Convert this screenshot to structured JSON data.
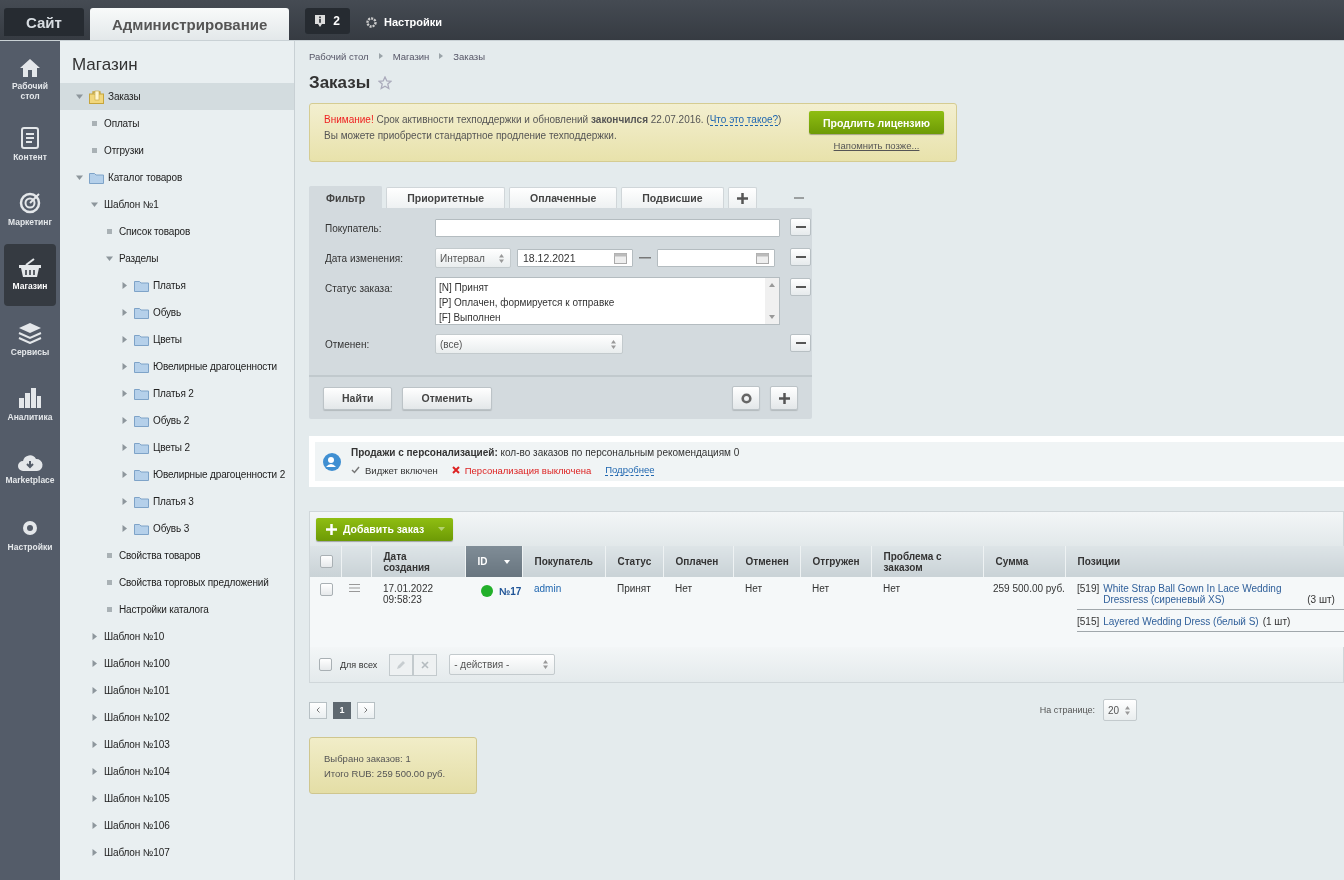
{
  "topbar": {
    "tabs": [
      {
        "label": "Сайт",
        "selected": false
      },
      {
        "label": "Администрирование",
        "selected": true
      }
    ],
    "notifications": "2",
    "settings": "Настройки"
  },
  "nav": [
    {
      "label": "Рабочий стол",
      "selected": false
    },
    {
      "label": "Контент",
      "selected": false
    },
    {
      "label": "Маркетинг",
      "selected": false
    },
    {
      "label": "Магазин",
      "selected": true
    },
    {
      "label": "Сервисы",
      "selected": false
    },
    {
      "label": "Аналитика",
      "selected": false
    },
    {
      "label": "Marketplace",
      "selected": false
    },
    {
      "label": "Настройки",
      "selected": false
    }
  ],
  "tree": {
    "title": "Магазин",
    "items": [
      {
        "label": "Заказы",
        "kind": "orders",
        "expanded": true,
        "selected": true,
        "children": [
          {
            "label": "Оплаты",
            "kind": "bullet",
            "selected": false
          },
          {
            "label": "Отгрузки",
            "kind": "bullet",
            "selected": false
          }
        ]
      },
      {
        "label": "Каталог товаров",
        "kind": "folder",
        "expanded": true,
        "selected": false,
        "children": [
          {
            "label": "Шаблон №1",
            "kind": "plain",
            "expanded": true,
            "selected": false,
            "children": [
              {
                "label": "Список товаров",
                "kind": "bullet",
                "selected": false
              },
              {
                "label": "Разделы",
                "kind": "plain",
                "expanded": true,
                "selected": false,
                "children": [
                  {
                    "label": "Платья",
                    "kind": "folder",
                    "expanded": false,
                    "selected": false
                  },
                  {
                    "label": "Обувь",
                    "kind": "folder",
                    "expanded": false,
                    "selected": false
                  },
                  {
                    "label": "Цветы",
                    "kind": "folder",
                    "expanded": false,
                    "selected": false
                  },
                  {
                    "label": "Ювелирные драгоценности",
                    "kind": "folder",
                    "expanded": false,
                    "selected": false
                  },
                  {
                    "label": "Платья 2",
                    "kind": "folder",
                    "expanded": false,
                    "selected": false
                  },
                  {
                    "label": "Обувь 2",
                    "kind": "folder",
                    "expanded": false,
                    "selected": false
                  },
                  {
                    "label": "Цветы 2",
                    "kind": "folder",
                    "expanded": false,
                    "selected": false
                  },
                  {
                    "label": "Ювелирные драгоценности 2",
                    "kind": "folder",
                    "expanded": false,
                    "selected": false
                  },
                  {
                    "label": "Платья 3",
                    "kind": "folder",
                    "expanded": false,
                    "selected": false
                  },
                  {
                    "label": "Обувь 3",
                    "kind": "folder",
                    "expanded": false,
                    "selected": false
                  }
                ]
              },
              {
                "label": "Свойства товаров",
                "kind": "bullet",
                "selected": false
              },
              {
                "label": "Свойства торговых предложений",
                "kind": "bullet",
                "selected": false
              },
              {
                "label": "Настройки каталога",
                "kind": "bullet",
                "selected": false
              }
            ]
          },
          {
            "label": "Шаблон №10",
            "kind": "plain",
            "expanded": false,
            "selected": false
          },
          {
            "label": "Шаблон №100",
            "kind": "plain",
            "expanded": false,
            "selected": false
          },
          {
            "label": "Шаблон №101",
            "kind": "plain",
            "expanded": false,
            "selected": false
          },
          {
            "label": "Шаблон №102",
            "kind": "plain",
            "expanded": false,
            "selected": false
          },
          {
            "label": "Шаблон №103",
            "kind": "plain",
            "expanded": false,
            "selected": false
          },
          {
            "label": "Шаблон №104",
            "kind": "plain",
            "expanded": false,
            "selected": false
          },
          {
            "label": "Шаблон №105",
            "kind": "plain",
            "expanded": false,
            "selected": false
          },
          {
            "label": "Шаблон №106",
            "kind": "plain",
            "expanded": false,
            "selected": false
          },
          {
            "label": "Шаблон №107",
            "kind": "plain",
            "expanded": false,
            "selected": false
          }
        ]
      }
    ]
  },
  "breadcrumbs": [
    "Рабочий стол",
    "Магазин",
    "Заказы"
  ],
  "page_title": "Заказы",
  "notice": {
    "alert": "Внимание!",
    "text": "Срок активности техподдержки и обновлений **закончился** 22.07.2016. (",
    "link": "Что это такое?",
    "after": ")",
    "line2": "Вы можете приобрести стандартное продление техподдержки.",
    "button": "Продлить лицензию",
    "remind": "Напомнить позже..."
  },
  "filter": {
    "tabs": [
      {
        "label": "Фильтр",
        "selected": true
      },
      {
        "label": "Приоритетные",
        "selected": false
      },
      {
        "label": "Оплаченные",
        "selected": false
      },
      {
        "label": "Подвисшие",
        "selected": false
      }
    ],
    "rows": [
      {
        "kind": "text",
        "label": "Покупатель:"
      },
      {
        "kind": "interval",
        "label": "Дата изменения:",
        "mode": "Интервал",
        "from": "18.12.2021"
      },
      {
        "kind": "listbox",
        "label": "Статус заказа:",
        "options": [
          {
            "label": "[N] Принят",
            "selected": false
          },
          {
            "label": "[P] Оплачен, формируется к отправке",
            "selected": false
          },
          {
            "label": "[F] Выполнен",
            "selected": false
          }
        ]
      },
      {
        "kind": "select",
        "label": "Отменен:",
        "value": "(все)"
      }
    ],
    "buttons": [
      "Найти",
      "Отменить"
    ]
  },
  "personalization": {
    "title": "**Продажи с персонализацией:** кол-во заказов по персональным рекомендациям 0",
    "statuses": [
      {
        "label": "Виджет включен",
        "on": true
      },
      {
        "label": "Персонализация выключена",
        "on": false
      }
    ],
    "link": "Подробнее"
  },
  "orders": {
    "add_button": "Добавить заказ",
    "select_all": false,
    "columns": [
      {
        "label": "Дата создания",
        "sorted": false
      },
      {
        "label": "ID",
        "sorted": true
      },
      {
        "label": "Покупатель",
        "sorted": false
      },
      {
        "label": "Статус",
        "sorted": false
      },
      {
        "label": "Оплачен",
        "sorted": false
      },
      {
        "label": "Отменен",
        "sorted": false
      },
      {
        "label": "Отгружен",
        "sorted": false
      },
      {
        "label": "Проблема с заказом",
        "sorted": false
      },
      {
        "label": "Сумма",
        "sorted": false
      },
      {
        "label": "Позиции",
        "sorted": false
      }
    ],
    "rows": [
      {
        "checked": false,
        "created": "17.01.2022 09:58:23",
        "color": "#22b02a",
        "id": "№17",
        "buyer": "admin",
        "status": "Принят",
        "paid": "Нет",
        "canceled": "Нет",
        "shipped": "Нет",
        "problem": "Нет",
        "sum": "259 500.00 руб.",
        "positions": [
          {
            "code": "[519]",
            "name": "White Strap Ball Gown In Lace Wedding Dressress (сиреневый XS)",
            "qty": "(3 шт)"
          },
          {
            "code": "[515]",
            "name": "Layered Wedding Dress (белый S)",
            "qty": "(1 шт)"
          }
        ]
      }
    ],
    "for_all": {
      "label": "Для всех",
      "checked": false
    },
    "actions": "- действия -"
  },
  "pager": {
    "pages": [
      {
        "label": "1",
        "selected": true
      }
    ],
    "per_page_label": "На странице:",
    "per_page": "20"
  },
  "summary": [
    "Выбрано заказов: 1",
    "Итого RUB: 259 500.00 руб."
  ]
}
